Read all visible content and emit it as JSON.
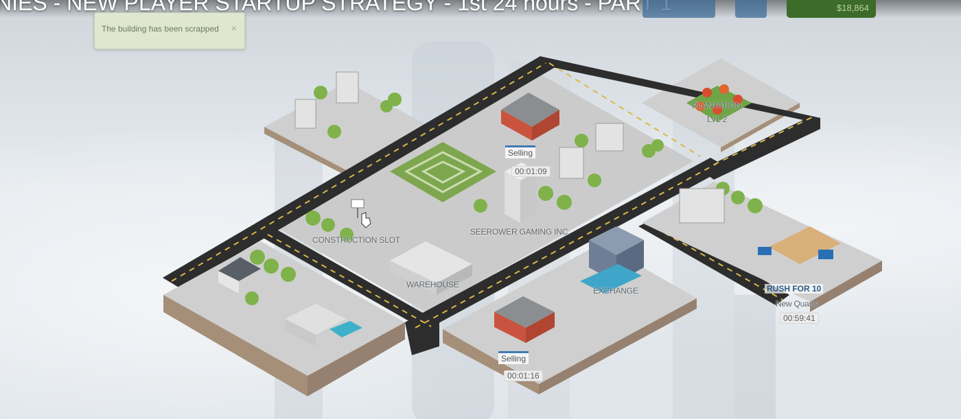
{
  "video": {
    "title": "NIES - NEW PLAYER STARTUP STRATEGY - 1st 24 hours - PART 1"
  },
  "hud": {
    "money": "$18,864"
  },
  "notification": {
    "message": "The building has been scrapped",
    "close": "×"
  },
  "map": {
    "plantation": {
      "name": "PLANTATION",
      "level": "LVL 2"
    },
    "selling_top": {
      "label": "Selling",
      "timer": "00:01:09"
    },
    "company": {
      "name": "SEEROWER GAMING INC."
    },
    "construction_slot": {
      "label": "CONSTRUCTION SLOT"
    },
    "warehouse": {
      "label": "WAREHOUSE"
    },
    "exchange": {
      "label": "EXCHANGE"
    },
    "quarry": {
      "rush": "RUSH FOR 10",
      "name": "New Quarry",
      "timer": "00:59:41"
    },
    "selling_bottom": {
      "label": "Selling",
      "timer": "00:01:16"
    }
  },
  "colors": {
    "tile_top": "#cfcfcf",
    "tile_side": "#a58f79",
    "road": "#2d2d2d",
    "road_line": "#d9b84a",
    "tree": "#7fb24a",
    "hud_money": "#3d6b2a"
  }
}
